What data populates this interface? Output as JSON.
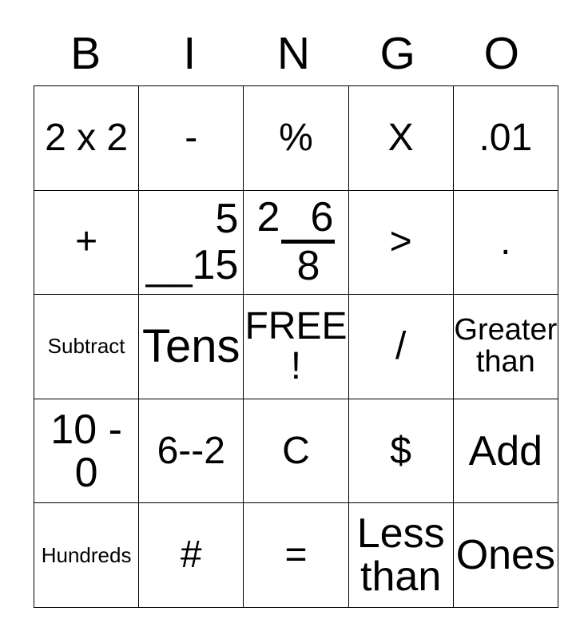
{
  "card": {
    "title": "BINGO",
    "header_letters": [
      "B",
      "I",
      "N",
      "G",
      "O"
    ],
    "columns": 5,
    "rows": 5,
    "border_color": "#000000",
    "background_color": "#ffffff",
    "text_color": "#000000",
    "free_space": {
      "label": "FREE!",
      "row": 3,
      "column": "N"
    },
    "cells": [
      [
        {
          "text": "2 x 2",
          "size": "lg",
          "lines": [
            "2 x 2"
          ]
        },
        {
          "text": "-",
          "size": "lg",
          "lines": [
            "-"
          ]
        },
        {
          "text": "%",
          "size": "lg",
          "lines": [
            "%"
          ]
        },
        {
          "text": "X",
          "size": "lg",
          "lines": [
            "X"
          ]
        },
        {
          "text": ".01",
          "size": "lg",
          "lines": [
            ".01"
          ]
        }
      ],
      [
        {
          "text": "+",
          "size": "lg",
          "lines": [
            "+"
          ]
        },
        {
          "text": "5 __15",
          "size": "xl",
          "lines": [
            "5",
            "__15"
          ],
          "align": "right"
        },
        {
          "text": "2 __6 8",
          "size": "xl",
          "whole": "2",
          "numerator": "6",
          "denominator": "8"
        },
        {
          "text": ">",
          "size": "lg",
          "lines": [
            ">"
          ]
        },
        {
          "text": ".",
          "size": "lg",
          "lines": [
            "."
          ]
        }
      ],
      [
        {
          "text": "Subtract",
          "size": "xs",
          "lines": [
            "Subtract"
          ]
        },
        {
          "text": "Tens",
          "size": "xxl",
          "lines": [
            "Tens"
          ]
        },
        {
          "text": "FREE!",
          "size": "lg",
          "lines": [
            "FREE!"
          ]
        },
        {
          "text": "/",
          "size": "lg",
          "lines": [
            "/"
          ]
        },
        {
          "text": "Greater than",
          "size": "md",
          "lines": [
            "Greater",
            "than"
          ]
        }
      ],
      [
        {
          "text": "10 - 0",
          "size": "xl",
          "lines": [
            "10 -",
            "0"
          ]
        },
        {
          "text": "6--2",
          "size": "lg",
          "lines": [
            "6--2"
          ]
        },
        {
          "text": "C",
          "size": "lg",
          "lines": [
            "C"
          ]
        },
        {
          "text": "$",
          "size": "lg",
          "lines": [
            "$"
          ]
        },
        {
          "text": "Add",
          "size": "xl",
          "lines": [
            "Add"
          ]
        }
      ],
      [
        {
          "text": "Hundreds",
          "size": "xs",
          "lines": [
            "Hundreds"
          ]
        },
        {
          "text": "#",
          "size": "lg",
          "lines": [
            "#"
          ]
        },
        {
          "text": "=",
          "size": "lg",
          "lines": [
            "="
          ]
        },
        {
          "text": "Less than",
          "size": "xl",
          "lines": [
            "Less",
            "than"
          ]
        },
        {
          "text": "Ones",
          "size": "xl",
          "lines": [
            "Ones"
          ]
        }
      ]
    ]
  }
}
